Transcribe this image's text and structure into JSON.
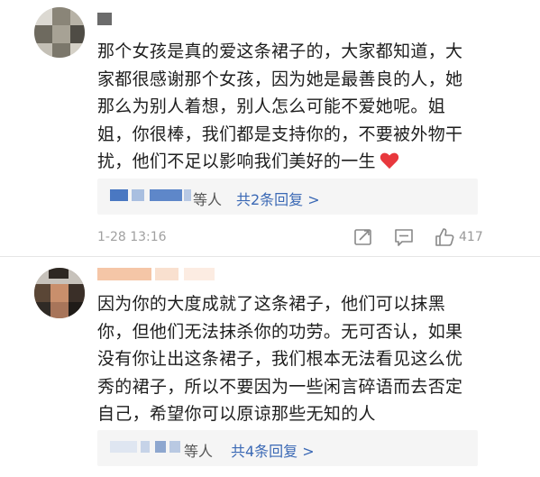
{
  "comments": [
    {
      "text": "那个女孩是真的爱这条裙子的，大家都知道，大\n家都很感谢那个女孩，因为她是最善良的人，她\n那么为别人着想，别人怎么可能不爱她呢。姐\n姐，你很棒，我们都是支持你的，不要被外物干\n扰，他们不足以影响我们美好的一生",
      "has_heart_emoji": true,
      "replies": {
        "suffix": "等人",
        "link": "共2条回复 >"
      },
      "timestamp": "1-28 13:16",
      "like_count": "417"
    },
    {
      "text": "因为你的大度成就了这条裙子，他们可以抹黑\n你，但他们无法抹杀你的功劳。无可否认，如果\n没有你让出这条裙子，我们根本无法看见这么优\n秀的裙子，所以不要因为一些闲言碎语而去否定\n自己，希望你可以原谅那些无知的人",
      "replies": {
        "suffix": "等人",
        "link": "共4条回复 >"
      }
    }
  ],
  "icons": {
    "share": "share-icon",
    "comment": "comment-icon",
    "like": "thumbs-up-icon",
    "heart": "heart-emoji-icon"
  },
  "colors": {
    "link": "#3b69b5",
    "heart": "#e8383d",
    "timestamp": "#a0a0a0",
    "reply_bg": "#f5f5f5"
  }
}
